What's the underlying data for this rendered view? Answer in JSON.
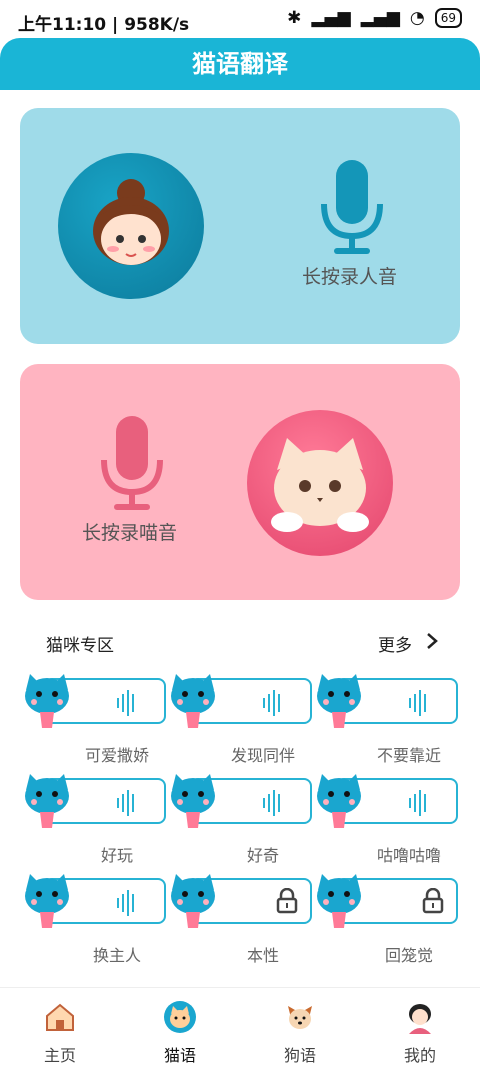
{
  "status_bar": {
    "time": "上午11:10",
    "speed": "958K/s",
    "battery": "69"
  },
  "header": {
    "title": "猫语翻译"
  },
  "human_card": {
    "label": "长按录人音"
  },
  "cat_card": {
    "label": "长按录喵音"
  },
  "section": {
    "title": "猫咪专区",
    "more": "更多"
  },
  "tiles": [
    {
      "label": "可爱撒娇",
      "locked": false
    },
    {
      "label": "发现同伴",
      "locked": false
    },
    {
      "label": "不要靠近",
      "locked": false
    },
    {
      "label": "好玩",
      "locked": false
    },
    {
      "label": "好奇",
      "locked": false
    },
    {
      "label": "咕噜咕噜",
      "locked": false
    },
    {
      "label": "换主人",
      "locked": false
    },
    {
      "label": "本性",
      "locked": true
    },
    {
      "label": "回笼觉",
      "locked": true
    }
  ],
  "tabs": [
    {
      "label": "主页",
      "icon": "home-icon"
    },
    {
      "label": "猫语",
      "icon": "cat-icon"
    },
    {
      "label": "狗语",
      "icon": "dog-icon"
    },
    {
      "label": "我的",
      "icon": "user-icon"
    }
  ],
  "colors": {
    "header": "#1ab5d6",
    "human_card": "#9fdbe9",
    "cat_card": "#ffb4c1"
  }
}
